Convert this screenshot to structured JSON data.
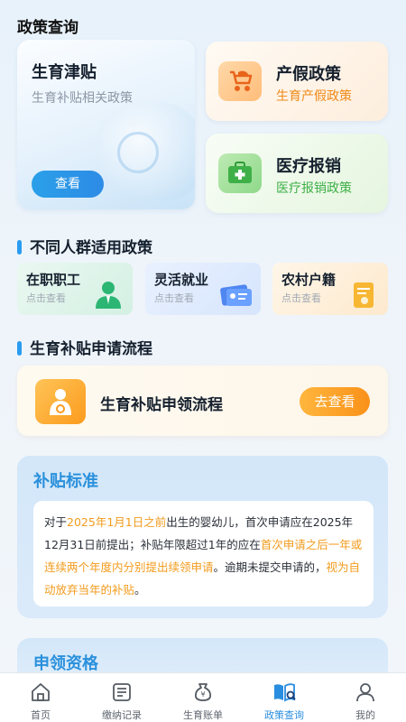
{
  "page_title": "政策查询",
  "top": {
    "big_card": {
      "title": "生育津贴",
      "subtitle": "生育补贴相关政策",
      "button": "查看"
    },
    "card1": {
      "title": "产假政策",
      "subtitle": "生育产假政策",
      "icon": "stroller-icon"
    },
    "card2": {
      "title": "医疗报销",
      "subtitle": "医疗报销政策",
      "icon": "medical-kit-icon"
    }
  },
  "groups": {
    "heading": "不同人群适用政策",
    "items": [
      {
        "title": "在职职工",
        "subtitle": "点击查看",
        "icon": "employee-icon"
      },
      {
        "title": "灵活就业",
        "subtitle": "点击查看",
        "icon": "id-card-icon"
      },
      {
        "title": "农村户籍",
        "subtitle": "点击查看",
        "icon": "document-icon"
      }
    ]
  },
  "flow": {
    "heading": "生育补贴申请流程",
    "title": "生育补贴申领流程",
    "button": "去查看"
  },
  "standard": {
    "heading": "补贴标准",
    "p1": "对于",
    "h1": "2025年1月1日之前",
    "p2": "出生的婴幼儿，首次申请应在2025年12月31日前提出；补贴年限超过1年的应在",
    "h2": "首次申请之后一年或连续两个年度内分别提出续领申请",
    "p3": "。逾期未提交申请的，",
    "h3": "视为自动放弃当年的补贴",
    "p4": "。"
  },
  "qualification": {
    "heading": "申领资格"
  },
  "tabbar": [
    {
      "label": "首页",
      "icon": "home-icon",
      "active": false
    },
    {
      "label": "缴纳记录",
      "icon": "list-icon",
      "active": false
    },
    {
      "label": "生育账单",
      "icon": "money-bag-icon",
      "active": false
    },
    {
      "label": "政策查询",
      "icon": "policy-book-icon",
      "active": true
    },
    {
      "label": "我的",
      "icon": "user-icon",
      "active": false
    }
  ],
  "colors": {
    "accent": "#2a8ee0",
    "orange": "#f9911a",
    "green": "#3fb048"
  }
}
